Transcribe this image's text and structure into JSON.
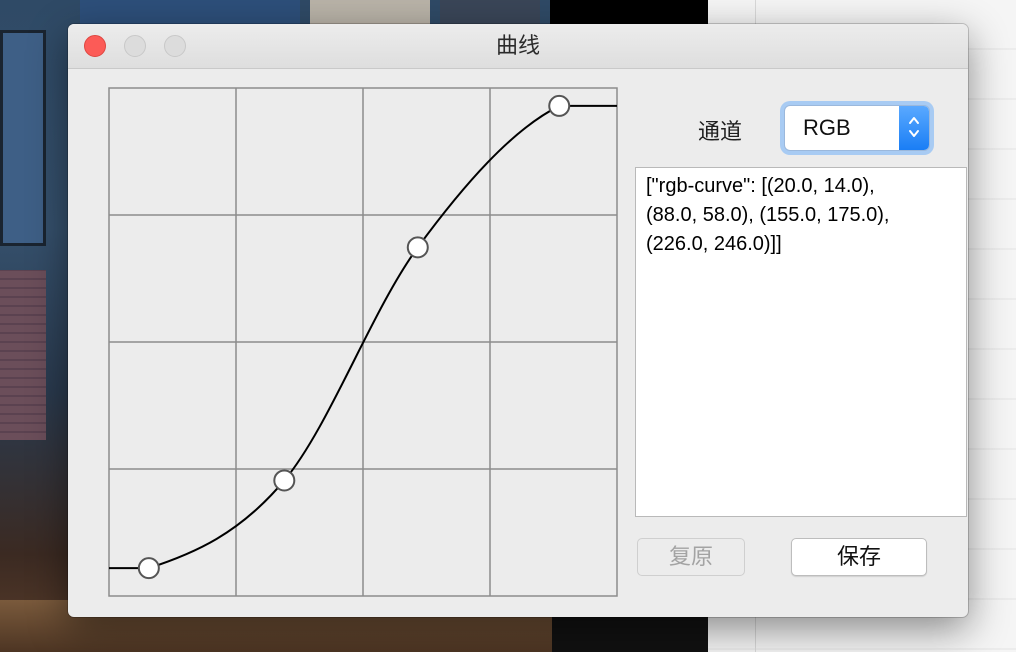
{
  "window": {
    "title": "曲线"
  },
  "channel": {
    "label": "通道",
    "selected": "RGB"
  },
  "output": {
    "text": "[\"rgb-curve\": [(20.0, 14.0),\n(88.0, 58.0), (155.0, 175.0),\n(226.0, 246.0)]]"
  },
  "buttons": {
    "reset_label": "复原",
    "save_label": "保存"
  },
  "icons": {
    "channel_stepper": "up-down-chevron-icon"
  },
  "curve": {
    "range": [
      0,
      255
    ],
    "grid_divisions": 4,
    "points": [
      {
        "x": 20.0,
        "y": 14.0
      },
      {
        "x": 88.0,
        "y": 58.0
      },
      {
        "x": 155.0,
        "y": 175.0
      },
      {
        "x": 226.0,
        "y": 246.0
      }
    ]
  },
  "colors": {
    "close_button": "#fc5b57",
    "select_accent": "#1a7ef5",
    "grid_line": "#8c8c8c",
    "curve_line": "#000000"
  }
}
